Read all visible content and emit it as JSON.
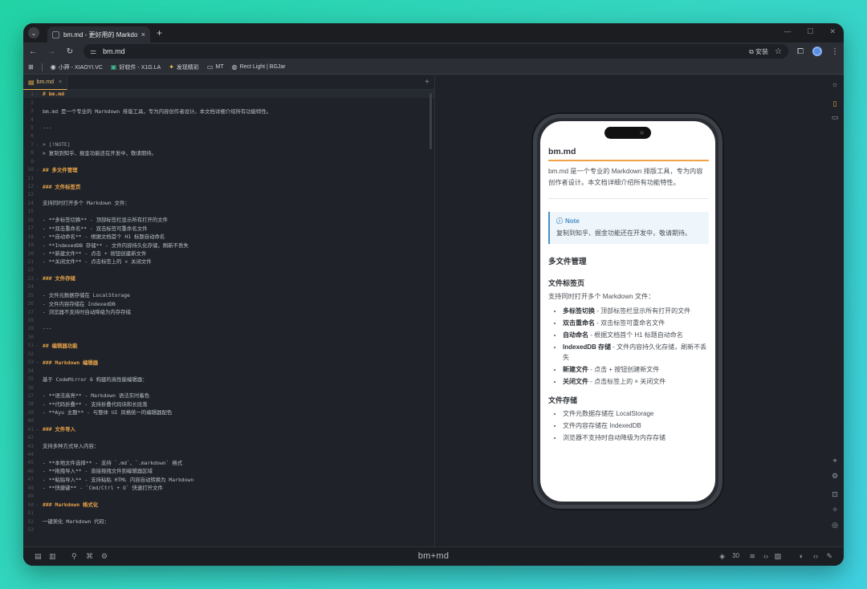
{
  "browser": {
    "tab_title": "bm.md - 更好用的 Markdown",
    "tab_close": "×",
    "new_tab": "+",
    "address": "bm.md",
    "install_label": "安装",
    "window_controls": [
      "—",
      "☐",
      "✕"
    ]
  },
  "bookmarks": [
    {
      "icon": "github-icon",
      "label": "小莽 - XIAOYI.VC"
    },
    {
      "icon": "app-icon",
      "label": "好软件 - X1G.LA"
    },
    {
      "icon": "spark-icon",
      "label": "发现精彩"
    },
    {
      "icon": "folder-icon",
      "label": "MT"
    },
    {
      "icon": "globe-icon",
      "label": "Rect Light | BGJar"
    }
  ],
  "file_tab": {
    "name": "bm.md",
    "close": "×",
    "add": "+"
  },
  "editor_lines": [
    {
      "n": "1",
      "text": "# bm.md",
      "type": "h"
    },
    {
      "n": "2",
      "text": "",
      "type": ""
    },
    {
      "n": "3",
      "text": "bm.md 是一个专业的 Markdown 排版工具，专为内容创作者设计。本文档详细介绍所有功能特性。",
      "type": ""
    },
    {
      "n": "4",
      "text": "",
      "type": ""
    },
    {
      "n": "5",
      "text": "---",
      "type": "ann"
    },
    {
      "n": "6",
      "text": "",
      "type": ""
    },
    {
      "n": "7",
      "text": "> [!NOTE]",
      "type": "ann"
    },
    {
      "n": "8",
      "text": "> 复制到知乎、掘金功能还在开发中，敬请期待。",
      "type": ""
    },
    {
      "n": "9",
      "text": "",
      "type": ""
    },
    {
      "n": "10",
      "text": "## 多文件管理",
      "type": "h"
    },
    {
      "n": "11",
      "text": "",
      "type": ""
    },
    {
      "n": "12",
      "text": "### 文件标签页",
      "type": "h"
    },
    {
      "n": "13",
      "text": "",
      "type": ""
    },
    {
      "n": "14",
      "text": "支持同时打开多个 Markdown 文件：",
      "type": ""
    },
    {
      "n": "15",
      "text": "",
      "type": ""
    },
    {
      "n": "16",
      "text": "- **多标签切换** - 顶部标签栏显示所有打开的文件",
      "type": ""
    },
    {
      "n": "17",
      "text": "- **双击重命名** - 双击标签可重命名文件",
      "type": ""
    },
    {
      "n": "18",
      "text": "- **自动命名** - 根据文档首个 H1 标题自动命名",
      "type": ""
    },
    {
      "n": "19",
      "text": "- **IndexedDB 存储** - 文件内容持久化存储，刷新不丢失",
      "type": ""
    },
    {
      "n": "20",
      "text": "- **新建文件** - 点击 + 按钮创建新文件",
      "type": ""
    },
    {
      "n": "21",
      "text": "- **关闭文件** - 点击标签上的 × 关闭文件",
      "type": ""
    },
    {
      "n": "22",
      "text": "",
      "type": ""
    },
    {
      "n": "23",
      "text": "### 文件存储",
      "type": "h"
    },
    {
      "n": "24",
      "text": "",
      "type": ""
    },
    {
      "n": "25",
      "text": "- 文件元数据存储在 LocalStorage",
      "type": ""
    },
    {
      "n": "26",
      "text": "- 文件内容存储在 IndexedDB",
      "type": ""
    },
    {
      "n": "27",
      "text": "- 浏览器不支持时自动降级为内存存储",
      "type": ""
    },
    {
      "n": "28",
      "text": "",
      "type": ""
    },
    {
      "n": "29",
      "text": "---",
      "type": "ann"
    },
    {
      "n": "30",
      "text": "",
      "type": ""
    },
    {
      "n": "31",
      "text": "## 编辑器功能",
      "type": "h"
    },
    {
      "n": "32",
      "text": "",
      "type": ""
    },
    {
      "n": "33",
      "text": "### Markdown 编辑器",
      "type": "h"
    },
    {
      "n": "34",
      "text": "",
      "type": ""
    },
    {
      "n": "35",
      "text": "基于 CodeMirror 6 构建的高性能编辑器：",
      "type": ""
    },
    {
      "n": "36",
      "text": "",
      "type": ""
    },
    {
      "n": "37",
      "text": "- **语法高亮** - Markdown 语法实时着色",
      "type": ""
    },
    {
      "n": "38",
      "text": "- **代码折叠** - 支持折叠代码块和长段落",
      "type": ""
    },
    {
      "n": "39",
      "text": "- **Ayu 主题** - 与整体 UI 风格统一的编辑器配色",
      "type": ""
    },
    {
      "n": "40",
      "text": "",
      "type": ""
    },
    {
      "n": "41",
      "text": "### 文件导入",
      "type": "h"
    },
    {
      "n": "42",
      "text": "",
      "type": ""
    },
    {
      "n": "43",
      "text": "支持多种方式导入内容：",
      "type": ""
    },
    {
      "n": "44",
      "text": "",
      "type": ""
    },
    {
      "n": "45",
      "text": "- **本地文件选择** - 支持 `.md`、`.markdown` 格式",
      "type": ""
    },
    {
      "n": "46",
      "text": "- **拖拽导入** - 直接拖拽文件到编辑器区域",
      "type": ""
    },
    {
      "n": "47",
      "text": "- **粘贴导入** - 支持粘贴 HTML 内容自动转换为 Markdown",
      "type": ""
    },
    {
      "n": "48",
      "text": "- **快捷键** - `Cmd/Ctrl + O` 快速打开文件",
      "type": ""
    },
    {
      "n": "49",
      "text": "",
      "type": ""
    },
    {
      "n": "50",
      "text": "### Markdown 格式化",
      "type": "h"
    },
    {
      "n": "51",
      "text": "",
      "type": ""
    },
    {
      "n": "52",
      "text": "一键美化 Markdown 代码：",
      "type": ""
    },
    {
      "n": "53",
      "text": "",
      "type": ""
    }
  ],
  "preview": {
    "title": "bm.md",
    "intro": "bm.md 是一个专业的 Markdown 排版工具，专为内容创作者设计。本文档详细介绍所有功能特性。",
    "note_title": "Note",
    "note_body": "复制到知乎、掘金功能还在开发中，敬请期待。",
    "h2": "多文件管理",
    "h3_tabs": "文件标签页",
    "tabs_intro": "支持同时打开多个 Markdown 文件：",
    "tab_items": [
      {
        "b": "多标签切换",
        "t": " - 顶部标签栏显示所有打开的文件"
      },
      {
        "b": "双击重命名",
        "t": " - 双击标签可重命名文件"
      },
      {
        "b": "自动命名",
        "t": " - 根据文档首个 H1 标题自动命名"
      },
      {
        "b": "IndexedDB 存储",
        "t": " - 文件内容持久化存储，刷新不丢失"
      },
      {
        "b": "新建文件",
        "t": " - 点击 + 按钮创建新文件"
      },
      {
        "b": "关闭文件",
        "t": " - 点击标签上的 × 关闭文件"
      }
    ],
    "h3_storage": "文件存储",
    "storage_items": [
      "文件元数据存储在 LocalStorage",
      "文件内容存储在 IndexedDB",
      "浏览器不支持时自动降级为内存存储"
    ]
  },
  "brand": "bm+md",
  "status_text": "30",
  "colors": {
    "accent": "#e8a24a",
    "note": "#4a90c8"
  }
}
